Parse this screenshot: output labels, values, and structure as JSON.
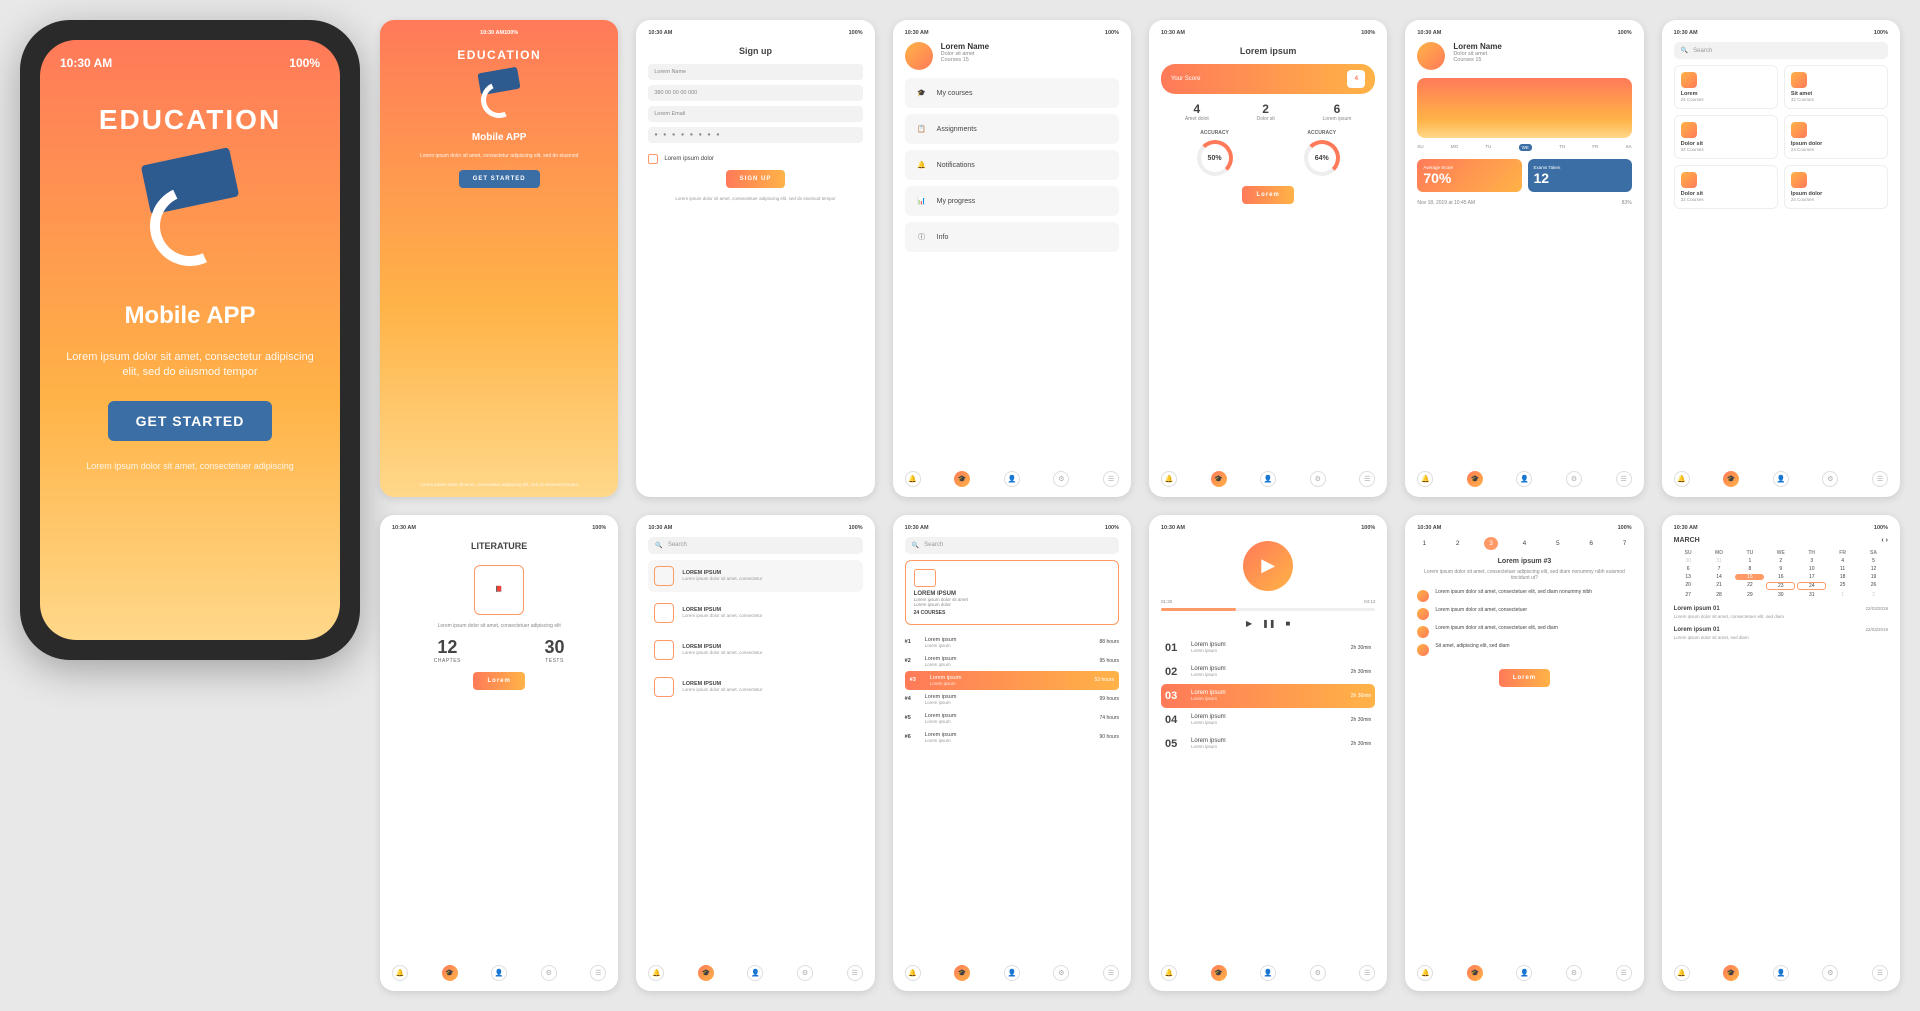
{
  "status": {
    "signal": "▮▮▮",
    "wifi": "⌔",
    "time": "10:30 AM",
    "battery": "100%"
  },
  "hero": {
    "title": "EDUCATION",
    "subtitle": "Mobile APP",
    "lorem": "Lorem ipsum dolor sit amet, consectetur adipiscing elit, sed do eiusmod tempor",
    "cta": "GET STARTED",
    "foot": "Lorem ipsum dolor sit amet, consectetuer adipiscing"
  },
  "splash": {
    "title": "EDUCATION",
    "subtitle": "Mobile APP",
    "text": "Lorem ipsum dolor sit amet, consectetur adipiscing elit, sed do eiusmod",
    "cta": "GET STARTED",
    "foot": "Lorem ipsum dolor sit amet, consectetur adipiscing elit, sed do eiusmod tempor"
  },
  "signup": {
    "title": "Sign up",
    "name_ph": "Lorem Name",
    "phone_ph": "380 00 00 00 000",
    "email_ph": "Lorem Email",
    "pass": "● ● ● ● ● ● ● ●",
    "terms": "Lorem ipsum dolor",
    "btn": "SIGN UP",
    "foot": "Lorem ipsum dolor sit amet, consectetuer adipiscing elit, sed do eiusmod tempor"
  },
  "menu": {
    "name": "Lorem Name",
    "meta1": "Dolor sit amet",
    "meta2": "Courses 15",
    "items": [
      "My courses",
      "Assignments",
      "Notifications",
      "My progress",
      "Info"
    ]
  },
  "score": {
    "title": "Lorem ipsum",
    "pill_label": "Your Score",
    "pill_val": "4",
    "triples": [
      {
        "v": "4",
        "l": "Amet dolot"
      },
      {
        "v": "2",
        "l": "Dolor sit"
      },
      {
        "v": "6",
        "l": "Lorem ipsum"
      }
    ],
    "acc_label": "ACCURACY",
    "g1": "50%",
    "g2": "64%",
    "btn": "Lorem"
  },
  "dash": {
    "name": "Lorem Name",
    "meta1": "Dolor sit amet",
    "meta2": "Courses 15",
    "days": [
      "SU",
      "MO",
      "TU",
      "WE",
      "TH",
      "FR",
      "SA"
    ],
    "card1_lbl": "Average Score",
    "card1_val": "70%",
    "card2_lbl": "Exams Taken",
    "card2_val": "12",
    "foot": "Nov 18, 2019 at 10:45 AM",
    "pct": "83%"
  },
  "browse": {
    "search_ph": "Search",
    "cats": [
      {
        "t": "Lorem",
        "s": "24 Courses"
      },
      {
        "t": "Sit amet",
        "s": "32 Courses"
      },
      {
        "t": "Dolor sit",
        "s": "32 Courses"
      },
      {
        "t": "Ipsum dolor",
        "s": "24 Courses"
      },
      {
        "t": "Dolor sit",
        "s": "32 Courses"
      },
      {
        "t": "Ipsum dolor",
        "s": "24 Courses"
      }
    ]
  },
  "lit": {
    "title": "LITERATURE",
    "desc": "Lorem ipsum dolor sit amet, consectetuer adipiscing elit",
    "chapters_n": "12",
    "chapters_l": "CHAPTES",
    "tests_n": "30",
    "tests_l": "TESTS",
    "btn": "Lorem"
  },
  "subjects": {
    "search_ph": "Search",
    "items": [
      {
        "t": "LOREM IPSUM",
        "s": "Lorem ipsum dolor sit amet, consectetur"
      },
      {
        "t": "LOREM IPSUM",
        "s": "Lorem ipsum dolor sit amet, consectetur"
      },
      {
        "t": "LOREM IPSUM",
        "s": "Lorem ipsum dolor sit amet, consectetur"
      },
      {
        "t": "LOREM IPSUM",
        "s": "Lorem ipsum dolor sit amet, consectetur"
      }
    ]
  },
  "leader": {
    "search_ph": "Search",
    "head_t": "LOREM IPSUM",
    "head_s1": "Lorem ipsum dolor sit amet",
    "head_s2": "Lorem ipsum dolor",
    "head_c": "24 COURSES",
    "rows": [
      {
        "r": "#1",
        "n": "Lorem ipsum",
        "s": "Lorem ipsum",
        "h": "88 hours"
      },
      {
        "r": "#2",
        "n": "Lorem ipsum",
        "s": "Lorem ipsum",
        "h": "95 hours"
      },
      {
        "r": "#3",
        "n": "Lorem ipsum",
        "s": "Lorem ipsum",
        "h": "53 hours"
      },
      {
        "r": "#4",
        "n": "Lorem ipsum",
        "s": "Lorem ipsum",
        "h": "99 hours"
      },
      {
        "r": "#5",
        "n": "Lorem ipsum",
        "s": "Lorem ipsum",
        "h": "74 hours"
      },
      {
        "r": "#6",
        "n": "Lorem ipsum",
        "s": "Lorem ipsum",
        "h": "90 hours"
      }
    ]
  },
  "lessons": {
    "t1": "01:32",
    "t2": "04:12",
    "rows": [
      {
        "n": "01",
        "t": "Lorem ipsum",
        "s": "Lorem ipsum",
        "d": "2h 30min"
      },
      {
        "n": "02",
        "t": "Lorem ipsum",
        "s": "Lorem ipsum",
        "d": "2h 30min"
      },
      {
        "n": "03",
        "t": "Lorem ipsum",
        "s": "Lorem ipsum",
        "d": "2h 30min"
      },
      {
        "n": "04",
        "t": "Lorem ipsum",
        "s": "Lorem ipsum",
        "d": "2h 30min"
      },
      {
        "n": "05",
        "t": "Lorem ipsum",
        "s": "Lorem ipsum",
        "d": "2h 30min"
      }
    ]
  },
  "detail": {
    "days": [
      "1",
      "2",
      "3",
      "4",
      "5",
      "6",
      "7"
    ],
    "title": "Lorem ipsum #3",
    "desc": "Lorem ipsum dolor sit amet, consectetuer adipiscing elit, sed diam nonummy nibh euismod tincidunt ut?",
    "ev": [
      "Lorem ipsum dolor sit amet, consectetuer elit, sed diam nonummy nibh",
      "Lorem ipsum dolor sit amet, consectetuer",
      "Lorem ipsum dolor sit amet, consectetuer elit, sed diam",
      "Sit amet, adipiscing elit, sed diam"
    ],
    "btn": "Lorem"
  },
  "calendar": {
    "month": "MARCH",
    "dow": [
      "SU",
      "MO",
      "TU",
      "WE",
      "TH",
      "FR",
      "SA"
    ],
    "weeks": [
      [
        "30",
        "31",
        "1",
        "2",
        "3",
        "4",
        "5"
      ],
      [
        "6",
        "7",
        "8",
        "9",
        "10",
        "11",
        "12"
      ],
      [
        "13",
        "14",
        "15",
        "16",
        "17",
        "18",
        "19"
      ],
      [
        "20",
        "21",
        "22",
        "23",
        "24",
        "25",
        "26"
      ],
      [
        "27",
        "28",
        "29",
        "30",
        "31",
        "1",
        "2"
      ]
    ],
    "tasks": [
      {
        "t": "Lorem ipsum 01",
        "d": "22/03/2019",
        "s": "Lorem ipsum dolor sit amet, consectetuer elit, sed diam"
      },
      {
        "t": "Lorem ipsum 01",
        "d": "22/03/2019",
        "s": "Lorem ipsum dolor sit amet, sed diam"
      }
    ]
  },
  "nav_icons": [
    "🔔",
    "🎓",
    "👤",
    "⚙",
    "☰"
  ]
}
